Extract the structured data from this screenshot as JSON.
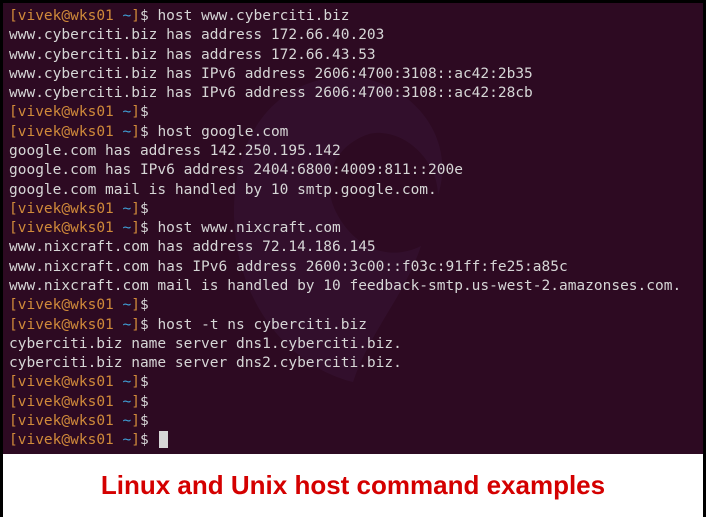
{
  "prompt": {
    "open": "[",
    "user": "vivek",
    "at": "@",
    "host": "wks01",
    "path": " ~",
    "close": "]",
    "dollar": "$ "
  },
  "lines": [
    {
      "type": "prompt",
      "cmd": "host www.cyberciti.biz"
    },
    {
      "type": "out",
      "text": "www.cyberciti.biz has address 172.66.40.203"
    },
    {
      "type": "out",
      "text": "www.cyberciti.biz has address 172.66.43.53"
    },
    {
      "type": "out",
      "text": "www.cyberciti.biz has IPv6 address 2606:4700:3108::ac42:2b35"
    },
    {
      "type": "out",
      "text": "www.cyberciti.biz has IPv6 address 2606:4700:3108::ac42:28cb"
    },
    {
      "type": "prompt",
      "cmd": ""
    },
    {
      "type": "prompt",
      "cmd": "host google.com"
    },
    {
      "type": "out",
      "text": "google.com has address 142.250.195.142"
    },
    {
      "type": "out",
      "text": "google.com has IPv6 address 2404:6800:4009:811::200e"
    },
    {
      "type": "out",
      "text": "google.com mail is handled by 10 smtp.google.com."
    },
    {
      "type": "prompt",
      "cmd": ""
    },
    {
      "type": "prompt",
      "cmd": "host www.nixcraft.com"
    },
    {
      "type": "out",
      "text": "www.nixcraft.com has address 72.14.186.145"
    },
    {
      "type": "out",
      "text": "www.nixcraft.com has IPv6 address 2600:3c00::f03c:91ff:fe25:a85c"
    },
    {
      "type": "out",
      "text": "www.nixcraft.com mail is handled by 10 feedback-smtp.us-west-2.amazonses.com."
    },
    {
      "type": "prompt",
      "cmd": ""
    },
    {
      "type": "prompt",
      "cmd": "host -t ns cyberciti.biz"
    },
    {
      "type": "out",
      "text": "cyberciti.biz name server dns1.cyberciti.biz."
    },
    {
      "type": "out",
      "text": "cyberciti.biz name server dns2.cyberciti.biz."
    },
    {
      "type": "prompt",
      "cmd": ""
    },
    {
      "type": "prompt",
      "cmd": ""
    },
    {
      "type": "prompt",
      "cmd": ""
    },
    {
      "type": "prompt",
      "cmd": "",
      "cursor": true
    }
  ],
  "caption": "Linux and Unix host command examples"
}
